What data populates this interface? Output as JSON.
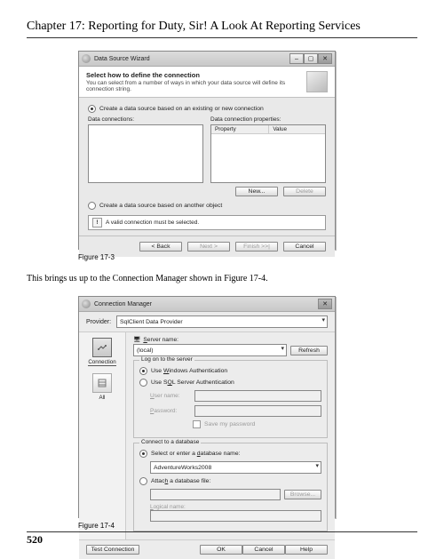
{
  "page": {
    "chapter_title": "Chapter 17: Reporting for Duty, Sir! A Look At Reporting Services",
    "body_text": "This brings us up to the Connection Manager shown in Figure 17-4.",
    "figure_3_caption": "Figure 17-3",
    "figure_4_caption": "Figure 17-4",
    "page_number": "520"
  },
  "fig3": {
    "window_title": "Data Source Wizard",
    "header_title": "Select how to define the connection",
    "header_sub": "You can select from a number of ways in which your data source will define its connection string.",
    "radio_existing": "Create a data source based on an existing or new connection",
    "col_left_label": "Data connections:",
    "col_right_label": "Data connection properties:",
    "prop_col_property": "Property",
    "prop_col_value": "Value",
    "btn_new": "New...",
    "btn_delete": "Delete",
    "radio_another": "Create a data source based on another object",
    "warn_text": "A valid connection must be selected.",
    "btn_back": "< Back",
    "btn_next": "Next >",
    "btn_finish": "Finish >>|",
    "btn_cancel": "Cancel"
  },
  "fig4": {
    "window_title": "Connection Manager",
    "provider_label": "Provider:",
    "provider_value": "SqlClient Data Provider",
    "side_connection": "Connection",
    "side_all": "All",
    "server_label": "Server name:",
    "server_value": "(local)",
    "btn_refresh": "Refresh",
    "group_logon": "Log on to the server",
    "radio_winauth": "Use Windows Authentication",
    "radio_sqlauth": "Use SQL Server Authentication",
    "user_label": "User name:",
    "pass_label": "Password:",
    "chk_savepw": "Save my password",
    "group_connectdb": "Connect to a database",
    "radio_selectdb": "Select or enter a database name:",
    "db_value": "AdventureWorks2008",
    "radio_attach": "Attach a database file:",
    "btn_browse": "Browse...",
    "logical_label": "Logical name:",
    "btn_test": "Test Connection",
    "btn_ok": "OK",
    "btn_cancel": "Cancel",
    "btn_help": "Help"
  }
}
